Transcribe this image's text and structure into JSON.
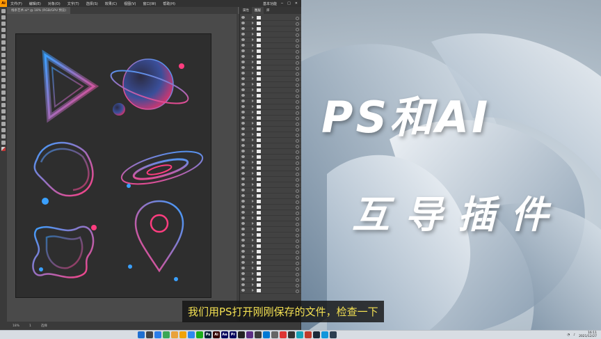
{
  "ai_window": {
    "logo": "Ai",
    "menu": [
      "文件(F)",
      "编辑(E)",
      "对象(O)",
      "文字(T)",
      "选择(S)",
      "效果(C)",
      "视图(V)",
      "窗口(W)",
      "帮助(H)"
    ],
    "workspace": "基本功能",
    "doc_tab": "线条艺术.ai* @ 18% (RGB/GPU 预览)",
    "panel_tabs": [
      "属性",
      "图层",
      "库"
    ],
    "panel_footer": "1 个图层",
    "zoom": "18%",
    "page": "1",
    "tool_status": "选择"
  },
  "overlay": {
    "title": "PS和AI",
    "subtitle": "互导插件"
  },
  "caption": "我们用PS打开刚刚保存的文件，检查一下",
  "taskbar": {
    "apps": [
      {
        "label": "",
        "color": "#1f6fd1"
      },
      {
        "label": "",
        "color": "#444"
      },
      {
        "label": "",
        "color": "#2b7de9"
      },
      {
        "label": "",
        "color": "#3aa757"
      },
      {
        "label": "",
        "color": "#e9a23b"
      },
      {
        "label": "",
        "color": "#f0a30a"
      },
      {
        "label": "",
        "color": "#2d89ef"
      },
      {
        "label": "",
        "color": "#1aad19"
      },
      {
        "label": "Ps",
        "color": "#001e36"
      },
      {
        "label": "Ai",
        "color": "#330000"
      },
      {
        "label": "Ae",
        "color": "#00005b"
      },
      {
        "label": "Pr",
        "color": "#00005b"
      },
      {
        "label": "",
        "color": "#222"
      },
      {
        "label": "",
        "color": "#5a2d82"
      },
      {
        "label": "",
        "color": "#3b3b3b"
      },
      {
        "label": "",
        "color": "#0078d4"
      },
      {
        "label": "",
        "color": "#666"
      },
      {
        "label": "",
        "color": "#d33"
      },
      {
        "label": "",
        "color": "#333"
      },
      {
        "label": "",
        "color": "#17a2b8"
      },
      {
        "label": "",
        "color": "#c0392b"
      },
      {
        "label": "",
        "color": "#1b2838"
      },
      {
        "label": "",
        "color": "#1296db"
      },
      {
        "label": "",
        "color": "#2c3e50"
      }
    ],
    "time": "16:11",
    "date": "2021/12/27"
  },
  "art_colors": {
    "blue": "#3aa0ff",
    "pink": "#ff3d7f"
  }
}
